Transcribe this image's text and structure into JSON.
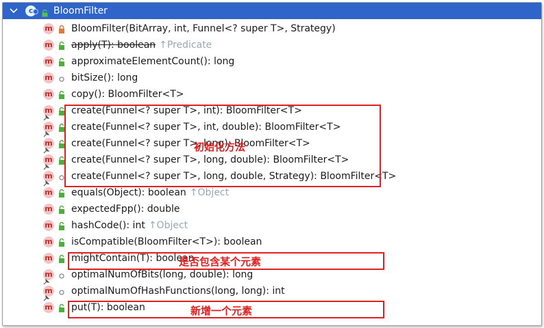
{
  "header": {
    "title": "BloomFilter"
  },
  "members": [
    {
      "text": "BloomFilter(BitArray, int, Funnel<? super T>, Strategy)",
      "vis": "private",
      "override": false,
      "struck": false,
      "inherit": ""
    },
    {
      "text": "apply(T): boolean",
      "vis": "public",
      "override": false,
      "struck": true,
      "inherit": "↑Predicate"
    },
    {
      "text": "approximateElementCount(): long",
      "vis": "public",
      "override": false,
      "struck": false,
      "inherit": ""
    },
    {
      "text": "bitSize(): long",
      "vis": "package",
      "override": false,
      "struck": false,
      "inherit": ""
    },
    {
      "text": "copy(): BloomFilter<T>",
      "vis": "public",
      "override": false,
      "struck": false,
      "inherit": ""
    },
    {
      "text": "create(Funnel<? super T>, int): BloomFilter<T>",
      "vis": "public",
      "override": true,
      "struck": false,
      "inherit": ""
    },
    {
      "text": "create(Funnel<? super T>, int, double): BloomFilter<T>",
      "vis": "public",
      "override": true,
      "struck": false,
      "inherit": ""
    },
    {
      "text": "create(Funnel<? super T>, long): BloomFilter<T>",
      "vis": "public",
      "override": true,
      "struck": false,
      "inherit": ""
    },
    {
      "text": "create(Funnel<? super T>, long, double): BloomFilter<T>",
      "vis": "public",
      "override": true,
      "struck": false,
      "inherit": ""
    },
    {
      "text": "create(Funnel<? super T>, long, double, Strategy): BloomFilter<T>",
      "vis": "package",
      "override": true,
      "struck": false,
      "inherit": ""
    },
    {
      "text": "equals(Object): boolean",
      "vis": "public",
      "override": false,
      "struck": false,
      "inherit": "↑Object"
    },
    {
      "text": "expectedFpp(): double",
      "vis": "public",
      "override": false,
      "struck": false,
      "inherit": ""
    },
    {
      "text": "hashCode(): int",
      "vis": "public",
      "override": false,
      "struck": false,
      "inherit": "↑Object"
    },
    {
      "text": "isCompatible(BloomFilter<T>): boolean",
      "vis": "public",
      "override": false,
      "struck": false,
      "inherit": ""
    },
    {
      "text": "mightContain(T): boolean",
      "vis": "public",
      "override": false,
      "struck": false,
      "inherit": ""
    },
    {
      "text": "optimalNumOfBits(long, double): long",
      "vis": "package",
      "override": true,
      "struck": false,
      "inherit": ""
    },
    {
      "text": "optimalNumOfHashFunctions(long, long): int",
      "vis": "package",
      "override": true,
      "struck": false,
      "inherit": ""
    },
    {
      "text": "put(T): boolean",
      "vis": "public",
      "override": false,
      "struck": false,
      "inherit": ""
    }
  ],
  "annotations": {
    "create_label": "初始化方法",
    "contain_label": "是否包含某个元素",
    "put_label": "新增一个元素"
  },
  "colors": {
    "header_bg": "#2f65ca",
    "annotation_red": "#e02020",
    "method_badge_bg": "#f3c4c4",
    "method_badge_fg": "#b8312f",
    "public_lock": "#4caf3c",
    "private_lock": "#e07a3c",
    "inherit_gray": "#9aa7b3"
  }
}
